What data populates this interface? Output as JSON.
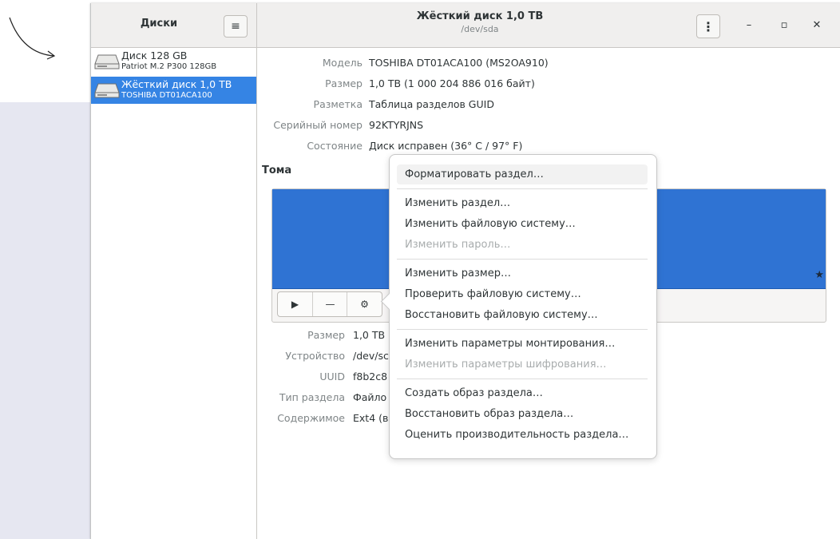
{
  "app": {
    "title": "Диски",
    "menu_icon": "hamburger-icon"
  },
  "window": {
    "title": "Жёсткий диск 1,0 ТВ",
    "subtitle": "/dev/sda"
  },
  "drives": [
    {
      "name": "Диск 128 GB",
      "model": "Patriot M.2 P300 128GB",
      "selected": false
    },
    {
      "name": "Жёсткий диск 1,0 ТВ",
      "model": "TOSHIBA DT01ACA100",
      "selected": true
    }
  ],
  "disk_props": [
    {
      "label": "Модель",
      "value": "TOSHIBA DT01ACA100 (MS2OA910)"
    },
    {
      "label": "Размер",
      "value": "1,0 ТВ (1 000 204 886 016 байт)"
    },
    {
      "label": "Разметка",
      "value": "Таблица разделов GUID"
    },
    {
      "label": "Серийный номер",
      "value": "92KTYRJNS"
    },
    {
      "label": "Состояние",
      "value": "Диск исправен (36° C / 97° F)"
    }
  ],
  "volumes": {
    "title": "Тома",
    "colors": {
      "partition": "#2f73d3",
      "selected_accent": "#3584e4"
    }
  },
  "volume_props": [
    {
      "label": "Размер",
      "value": "1,0 ТВ"
    },
    {
      "label": "Устройство",
      "value": "/dev/sc"
    },
    {
      "label": "UUID",
      "value": "f8b2c8"
    },
    {
      "label": "Тип раздела",
      "value": "Файло"
    },
    {
      "label": "Содержимое",
      "value": "Ext4 (в"
    }
  ],
  "menu": {
    "items": [
      {
        "label": "Форматировать раздел…",
        "enabled": true,
        "highlighted": true
      },
      {
        "label": "Изменить раздел…",
        "enabled": true
      },
      {
        "label": "Изменить файловую систему…",
        "enabled": true
      },
      {
        "label": "Изменить пароль…",
        "enabled": false
      },
      {
        "label": "Изменить размер…",
        "enabled": true
      },
      {
        "label": "Проверить файловую систему…",
        "enabled": true
      },
      {
        "label": "Восстановить файловую систему…",
        "enabled": true
      },
      {
        "label": "Изменить параметры монтирования…",
        "enabled": true
      },
      {
        "label": "Изменить параметры шифрования…",
        "enabled": false
      },
      {
        "label": "Создать образ раздела…",
        "enabled": true
      },
      {
        "label": "Восстановить образ раздела…",
        "enabled": true
      },
      {
        "label": "Оценить производительность раздела…",
        "enabled": true
      }
    ]
  }
}
